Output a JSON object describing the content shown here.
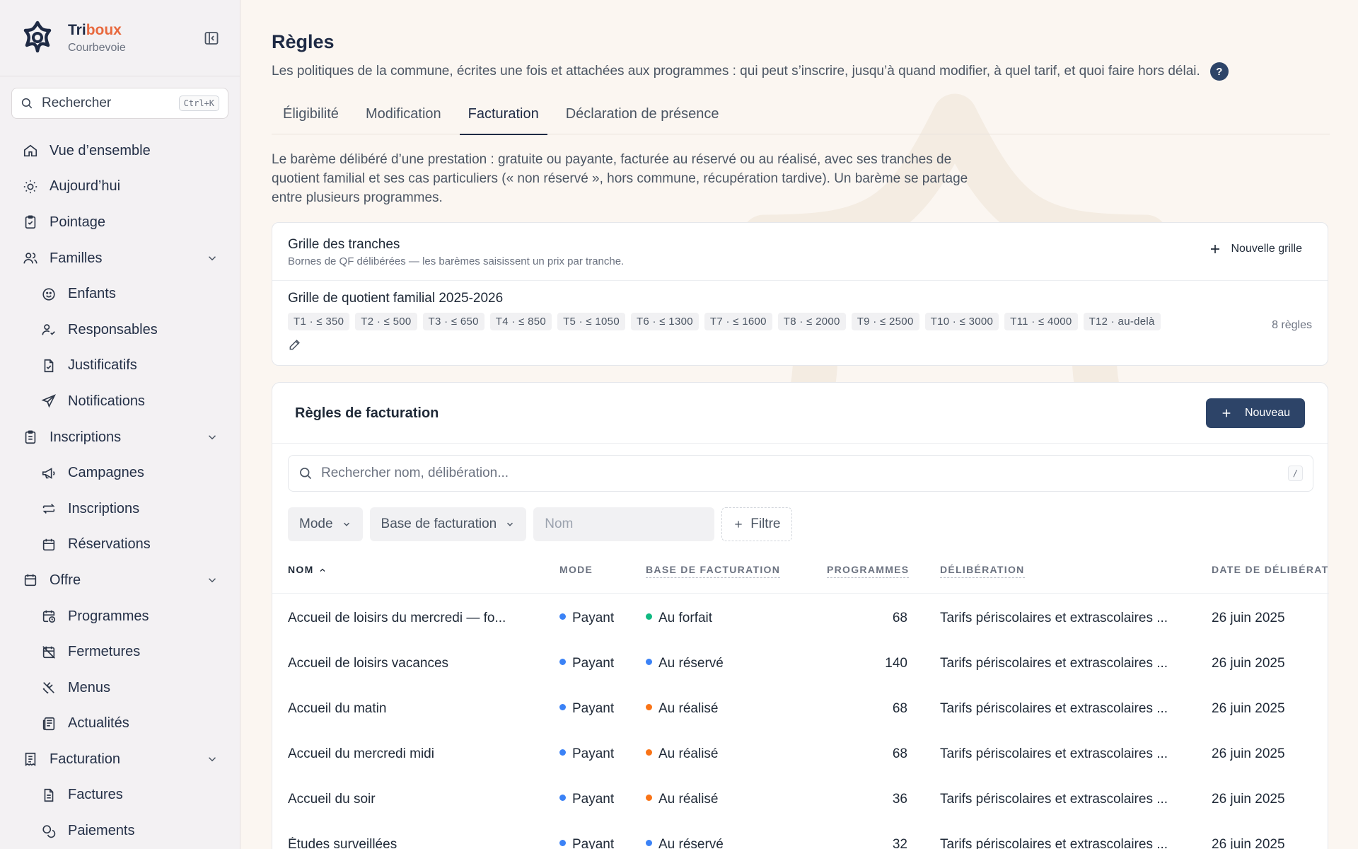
{
  "brand": {
    "name_a": "Tri",
    "name_b": "boux",
    "city": "Courbevoie"
  },
  "sidebar": {
    "search_label": "Rechercher",
    "search_shortcut": "Ctrl+K",
    "items": [
      {
        "label": "Vue d’ensemble",
        "icon": "home-icon"
      },
      {
        "label": "Aujourd’hui",
        "icon": "sun-icon"
      },
      {
        "label": "Pointage",
        "icon": "clipboard-check-icon"
      },
      {
        "label": "Familles",
        "icon": "users-icon",
        "expanded": true
      },
      {
        "label": "Enfants",
        "icon": "smile-icon"
      },
      {
        "label": "Responsables",
        "icon": "user-check-icon"
      },
      {
        "label": "Justificatifs",
        "icon": "file-check-icon"
      },
      {
        "label": "Notifications",
        "icon": "send-icon"
      },
      {
        "label": "Inscriptions",
        "icon": "clipboard-list-icon",
        "expanded": true
      },
      {
        "label": "Campagnes",
        "icon": "megaphone-icon"
      },
      {
        "label": "Inscriptions",
        "icon": "arrows-exchange-icon"
      },
      {
        "label": "Réservations",
        "icon": "calendar-icon"
      },
      {
        "label": "Offre",
        "icon": "calendar-grid-icon",
        "expanded": true
      },
      {
        "label": "Programmes",
        "icon": "calendar-clock-icon"
      },
      {
        "label": "Fermetures",
        "icon": "calendar-off-icon"
      },
      {
        "label": "Menus",
        "icon": "utensils-icon"
      },
      {
        "label": "Actualités",
        "icon": "newspaper-icon"
      },
      {
        "label": "Facturation",
        "icon": "receipt-icon",
        "expanded": true
      },
      {
        "label": "Factures",
        "icon": "file-text-icon"
      },
      {
        "label": "Paiements",
        "icon": "coins-icon"
      }
    ]
  },
  "page": {
    "title": "Règles",
    "description": "Les politiques de la commune, écrites une fois et attachées aux programmes : qui peut s’inscrire, jusqu’à quand modifier, à quel tarif, et quoi faire hors délai.",
    "help": "?"
  },
  "tabs": [
    {
      "label": "Éligibilité",
      "active": false
    },
    {
      "label": "Modification",
      "active": false
    },
    {
      "label": "Facturation",
      "active": true
    },
    {
      "label": "Déclaration de présence",
      "active": false
    }
  ],
  "section_description": "Le barème délibéré d’une prestation : gratuite ou payante, facturée au réservé ou au réalisé, avec ses tranches de quotient familial et ses cas particuliers (« non réservé », hors commune, récupération tardive). Un barème se partage entre plusieurs programmes.",
  "grid_card": {
    "title": "Grille des tranches",
    "subtitle": "Bornes de QF délibérées — les barèmes saisissent un prix par tranche.",
    "new_button": "Nouvelle grille",
    "grid_name": "Grille de quotient familial 2025-2026",
    "chips": [
      "T1 · ≤ 350",
      "T2 · ≤ 500",
      "T3 · ≤ 650",
      "T4 · ≤ 850",
      "T5 · ≤ 1050",
      "T6 · ≤ 1300",
      "T7 · ≤ 1600",
      "T8 · ≤ 2000",
      "T9 · ≤ 2500",
      "T10 · ≤ 3000",
      "T11 · ≤ 4000",
      "T12 · au-delà"
    ],
    "rules_count": "8 règles"
  },
  "rules_card": {
    "title": "Règles de facturation",
    "new_button": "Nouveau",
    "search_placeholder": "Rechercher nom, délibération...",
    "search_shortcut": "/",
    "filters": {
      "mode": "Mode",
      "base": "Base de facturation",
      "name_placeholder": "Nom",
      "add": "Filtre"
    },
    "columns": [
      "NOM",
      "MODE",
      "BASE DE FACTURATION",
      "PROGRAMMES",
      "DÉLIBÉRATION",
      "DATE DE DÉLIBÉRAT"
    ],
    "rows": [
      {
        "name": "Accueil de loisirs du mercredi — fo...",
        "mode": "Payant",
        "base": "Au forfait",
        "base_color": "#10b981",
        "programmes": "68",
        "deliberation": "Tarifs périscolaires et extrascolaires ...",
        "date": "26 juin 2025"
      },
      {
        "name": "Accueil de loisirs vacances",
        "mode": "Payant",
        "base": "Au réservé",
        "base_color": "#3b82f6",
        "programmes": "140",
        "deliberation": "Tarifs périscolaires et extrascolaires ...",
        "date": "26 juin 2025"
      },
      {
        "name": "Accueil du matin",
        "mode": "Payant",
        "base": "Au réalisé",
        "base_color": "#f97316",
        "programmes": "68",
        "deliberation": "Tarifs périscolaires et extrascolaires ...",
        "date": "26 juin 2025"
      },
      {
        "name": "Accueil du mercredi midi",
        "mode": "Payant",
        "base": "Au réalisé",
        "base_color": "#f97316",
        "programmes": "68",
        "deliberation": "Tarifs périscolaires et extrascolaires ...",
        "date": "26 juin 2025"
      },
      {
        "name": "Accueil du soir",
        "mode": "Payant",
        "base": "Au réalisé",
        "base_color": "#f97316",
        "programmes": "36",
        "deliberation": "Tarifs périscolaires et extrascolaires ...",
        "date": "26 juin 2025"
      },
      {
        "name": "Études surveillées",
        "mode": "Payant",
        "base": "Au réservé",
        "base_color": "#3b82f6",
        "programmes": "32",
        "deliberation": "Tarifs périscolaires et extrascolaires ...",
        "date": "26 juin 2025"
      }
    ]
  },
  "colors": {
    "accent": "#2d4468",
    "brand_highlight": "#e8693e",
    "mode_dot": "#3b82f6"
  }
}
